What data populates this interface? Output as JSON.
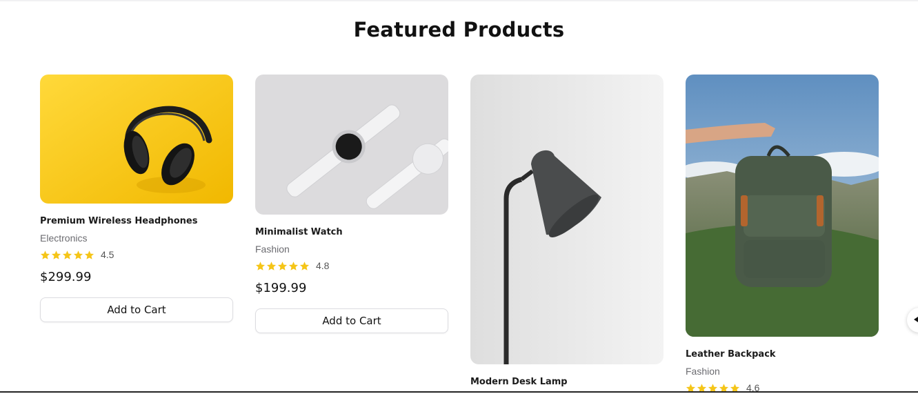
{
  "section": {
    "title": "Featured Products"
  },
  "products": [
    {
      "name": "Premium Wireless Headphones",
      "category": "Electronics",
      "rating": "4.5",
      "rating_value": 4.5,
      "price": "$299.99",
      "button": "Add to Cart"
    },
    {
      "name": "Minimalist Watch",
      "category": "Fashion",
      "rating": "4.8",
      "rating_value": 4.8,
      "price": "$199.99",
      "button": "Add to Cart"
    },
    {
      "name": "Modern Desk Lamp"
    },
    {
      "name": "Leather Backpack",
      "category": "Fashion",
      "rating": "4.6",
      "rating_value": 4.6
    }
  ],
  "colors": {
    "star": "#f5c518",
    "headphones_bg": "#f7c800"
  },
  "icons": {
    "star": "star-icon",
    "carousel_next": "chevron-left-icon"
  }
}
